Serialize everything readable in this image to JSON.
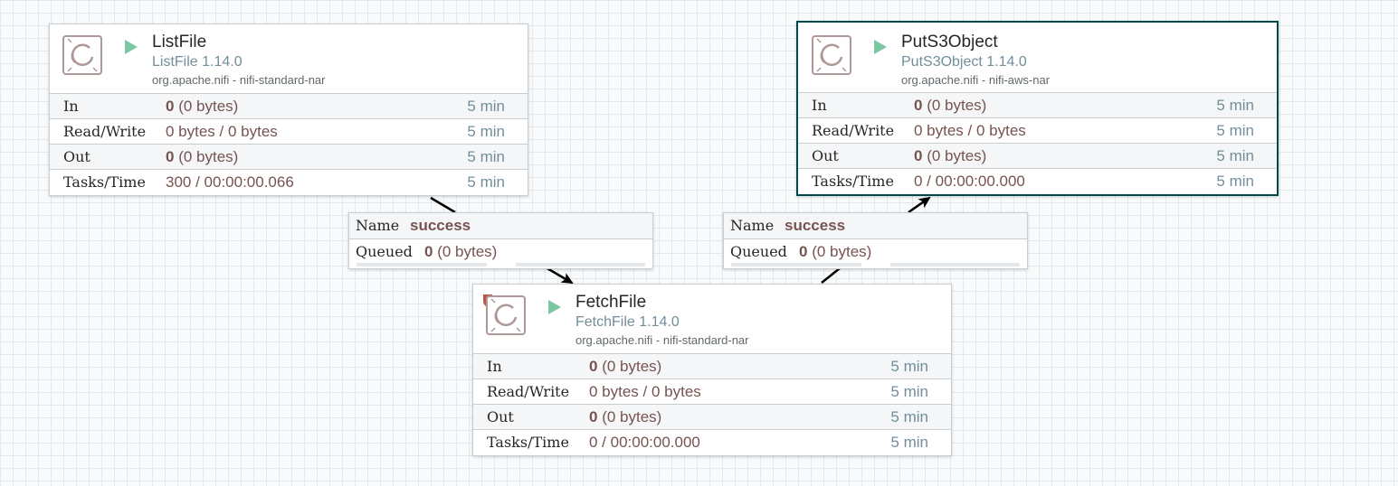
{
  "processors": [
    {
      "id": "listfile",
      "name": "ListFile",
      "type": "ListFile 1.14.0",
      "bundle": "org.apache.nifi - nifi-standard-nar",
      "state": "running",
      "restricted": false,
      "selected": false,
      "stats": {
        "in": {
          "label": "In",
          "count": "0",
          "detail": " (0 bytes)",
          "time": "5 min"
        },
        "read_write": {
          "label": "Read/Write",
          "value": "0 bytes / 0 bytes",
          "time": "5 min"
        },
        "out": {
          "label": "Out",
          "count": "0",
          "detail": " (0 bytes)",
          "time": "5 min"
        },
        "tasks_time": {
          "label": "Tasks/Time",
          "value": "300 / 00:00:00.066",
          "time": "5 min"
        }
      }
    },
    {
      "id": "puts3object",
      "name": "PutS3Object",
      "type": "PutS3Object 1.14.0",
      "bundle": "org.apache.nifi - nifi-aws-nar",
      "state": "running",
      "restricted": false,
      "selected": true,
      "stats": {
        "in": {
          "label": "In",
          "count": "0",
          "detail": " (0 bytes)",
          "time": "5 min"
        },
        "read_write": {
          "label": "Read/Write",
          "value": "0 bytes / 0 bytes",
          "time": "5 min"
        },
        "out": {
          "label": "Out",
          "count": "0",
          "detail": " (0 bytes)",
          "time": "5 min"
        },
        "tasks_time": {
          "label": "Tasks/Time",
          "value": "0 / 00:00:00.000",
          "time": "5 min"
        }
      }
    },
    {
      "id": "fetchfile",
      "name": "FetchFile",
      "type": "FetchFile 1.14.0",
      "bundle": "org.apache.nifi - nifi-standard-nar",
      "state": "running",
      "restricted": true,
      "selected": false,
      "stats": {
        "in": {
          "label": "In",
          "count": "0",
          "detail": " (0 bytes)",
          "time": "5 min"
        },
        "read_write": {
          "label": "Read/Write",
          "value": "0 bytes / 0 bytes",
          "time": "5 min"
        },
        "out": {
          "label": "Out",
          "count": "0",
          "detail": " (0 bytes)",
          "time": "5 min"
        },
        "tasks_time": {
          "label": "Tasks/Time",
          "value": "0 / 00:00:00.000",
          "time": "5 min"
        }
      }
    }
  ],
  "connections": [
    {
      "id": "listfile-to-fetchfile",
      "name_label": "Name",
      "name": "success",
      "queued_label": "Queued",
      "queued_count": "0",
      "queued_detail": " (0 bytes)",
      "backpressure_object_fraction": 0,
      "backpressure_size_fraction": 0
    },
    {
      "id": "fetchfile-to-puts3object",
      "name_label": "Name",
      "name": "success",
      "queued_label": "Queued",
      "queued_count": "0",
      "queued_detail": " (0 bytes)",
      "backpressure_object_fraction": 0,
      "backpressure_size_fraction": 0
    }
  ],
  "colors": {
    "canvas_background": "#f9fafb",
    "grid_line": "#e3e8eb",
    "run_icon": "#7dc7a0",
    "restricted_icon": "#ba554a",
    "selected_border": "#004849",
    "value_text": "#775351",
    "secondary_text": "#728e9b",
    "edge": "#000000"
  },
  "icons": {
    "processor": "processor-icon",
    "run": "play-icon",
    "restricted": "shield-icon"
  }
}
